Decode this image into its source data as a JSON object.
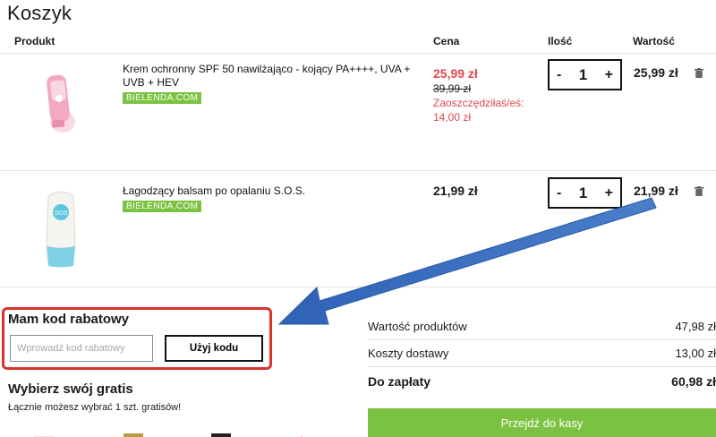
{
  "page": {
    "title": "Koszyk"
  },
  "table": {
    "headers": {
      "product": "Produkt",
      "price": "Cena",
      "qty": "Ilość",
      "value": "Wartość"
    }
  },
  "items": [
    {
      "name": "Krem ochronny SPF 50 nawilżająco - kojący PA++++, UVA + UVB + HEV",
      "badge": "BIELENDA.COM",
      "price_sale": "25,99 zł",
      "price_old": "39,99 zł",
      "saved": "Zaoszczędziłaś/eś: 14,00 zł",
      "qty": "1",
      "value": "25,99 zł"
    },
    {
      "name": "Łagodzący balsam po opalaniu S.O.S.",
      "badge": "BIELENDA.COM",
      "price": "21,99 zł",
      "qty": "1",
      "value": "21,99 zł"
    }
  ],
  "qty_controls": {
    "minus": "-",
    "plus": "+"
  },
  "coupon": {
    "title": "Mam kod rabatowy",
    "placeholder": "Wprowadź kod rabatowy",
    "button": "Użyj kodu"
  },
  "gifts": {
    "title": "Wybierz swój gratis",
    "subtitle": "Łącznie możesz wybrać 1 szt. gratisów!"
  },
  "summary": {
    "products_label": "Wartość produktów",
    "products_value": "47,98 zł",
    "shipping_label": "Koszty dostawy",
    "shipping_value": "13,00 zł",
    "total_label": "Do zapłaty",
    "total_value": "60,98 zł",
    "checkout": "Przejdź do kasy"
  },
  "colors": {
    "accent_green": "#7cc242",
    "sale_red": "#e0474c",
    "highlight_red": "#d8342c",
    "arrow_blue": "#3a6fc0"
  },
  "icons": [
    "trash-icon",
    "arrow-annotation"
  ]
}
